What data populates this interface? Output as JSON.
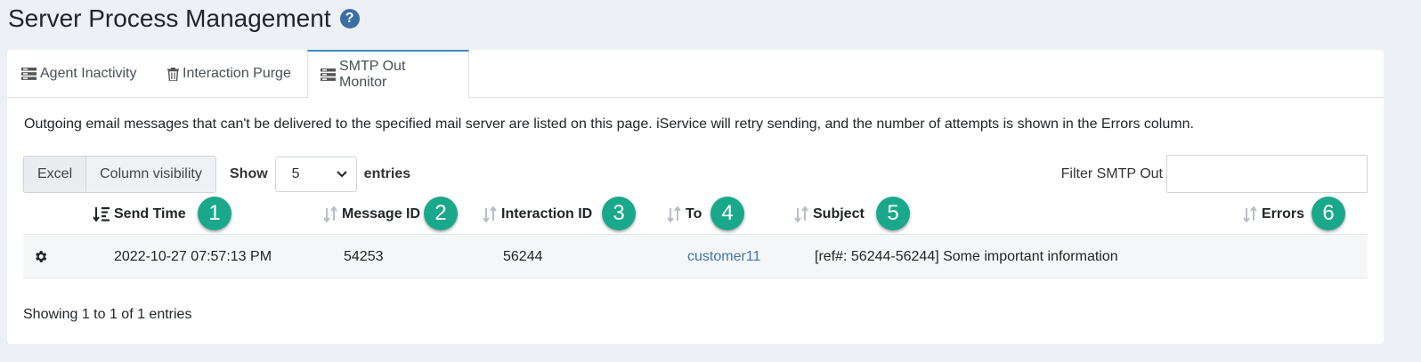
{
  "page": {
    "title": "Server Process Management",
    "help_glyph": "?"
  },
  "tabs": [
    {
      "label": "Agent Inactivity",
      "icon": "list-icon",
      "active": false
    },
    {
      "label": "Interaction Purge",
      "icon": "trash-icon",
      "active": false
    },
    {
      "label": "SMTP Out Monitor",
      "icon": "list-icon",
      "active": true
    }
  ],
  "description": "Outgoing email messages that can't be delivered to the specified mail server are listed on this page. iService will retry sending, and the number of attempts is shown in the Errors column.",
  "toolbar": {
    "excel_label": "Excel",
    "column_visibility_label": "Column visibility",
    "show_label": "Show",
    "page_length": "5",
    "entries_label": "entries",
    "filter_label": "Filter SMTP Out",
    "filter_value": ""
  },
  "table": {
    "columns": [
      {
        "label": "Send Time",
        "badge": "1",
        "sorted": true
      },
      {
        "label": "Message ID",
        "badge": "2",
        "sorted": false
      },
      {
        "label": "Interaction ID",
        "badge": "3",
        "sorted": false
      },
      {
        "label": "To",
        "badge": "4",
        "sorted": false
      },
      {
        "label": "Subject",
        "badge": "5",
        "sorted": false
      },
      {
        "label": "Errors",
        "badge": "6",
        "sorted": false
      }
    ],
    "rows": [
      {
        "send_time": "2022-10-27 07:57:13 PM",
        "message_id": "54253",
        "interaction_id": "56244",
        "to": "customer11",
        "subject": "[ref#: 56244-56244] Some important information",
        "errors": ""
      }
    ],
    "info": "Showing 1 to 1 of 1 entries"
  },
  "colors": {
    "accent": "#3c8dbc",
    "badge": "#1aa88a",
    "link": "#3c76b0"
  }
}
